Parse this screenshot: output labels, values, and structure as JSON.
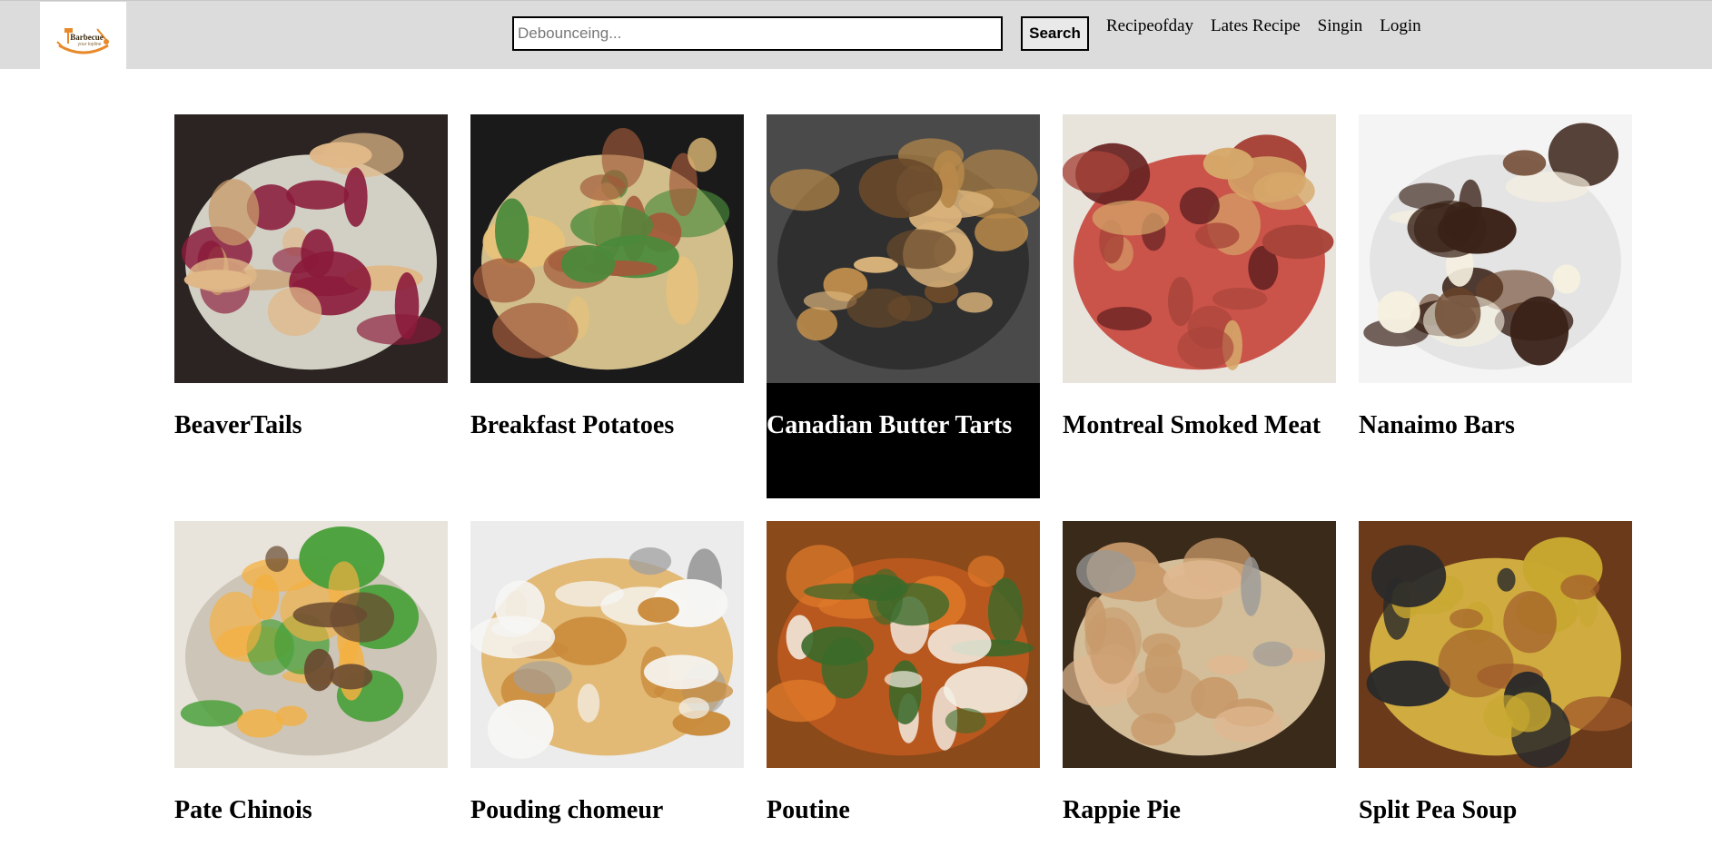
{
  "header": {
    "logo": {
      "text": "Barbecue",
      "subtext": "your topline",
      "icon": "bbq-utensils-icon",
      "accent": "#e8892a"
    },
    "search": {
      "placeholder": "Debounceing...",
      "value": "",
      "button_label": "Search"
    },
    "nav": [
      {
        "label": "Recipeofday"
      },
      {
        "label": "Lates Recipe"
      },
      {
        "label": "Singin"
      },
      {
        "label": "Login"
      }
    ]
  },
  "recipes": [
    {
      "title": "BeaverTails",
      "image": "beavertails-photo",
      "palette": [
        "#2b2422",
        "#c89a6a",
        "#e0b888",
        "#8a1a3a",
        "#f0eee0"
      ]
    },
    {
      "title": "Breakfast Potatoes",
      "image": "breakfast-potatoes-photo",
      "palette": [
        "#1a1a1a",
        "#e8c27a",
        "#a25a3a",
        "#4a8a3a",
        "#f2dca0"
      ]
    },
    {
      "title": "Canadian Butter Tarts",
      "image": "butter-tarts-photo",
      "palette": [
        "#4a4a4a",
        "#b8894a",
        "#6a4a2a",
        "#d9b27a",
        "#2a2a2a"
      ],
      "active": true
    },
    {
      "title": "Montreal Smoked Meat",
      "image": "smoked-meat-photo",
      "palette": [
        "#e8e4dc",
        "#a8443a",
        "#d6a86a",
        "#6a2424",
        "#c43a30"
      ]
    },
    {
      "title": "Nanaimo Bars",
      "image": "nanaimo-bars-photo",
      "palette": [
        "#f4f4f4",
        "#3a2218",
        "#f6f0e0",
        "#6a4228",
        "#e0e0e0"
      ]
    },
    {
      "title": "Pate Chinois",
      "image": "pate-chinois-photo",
      "palette": [
        "#e8e4dc",
        "#f4b040",
        "#6a4a30",
        "#4aa03a",
        "#c8c0b0"
      ]
    },
    {
      "title": "Pouding chomeur",
      "image": "pouding-chomeur-photo",
      "palette": [
        "#ececec",
        "#c98a3a",
        "#f6f6f4",
        "#a0a0a0",
        "#e0b060"
      ]
    },
    {
      "title": "Poutine",
      "image": "poutine-photo",
      "palette": [
        "#8a4a1a",
        "#e07a2a",
        "#f4f0e6",
        "#3a6a2a",
        "#c05a20"
      ]
    },
    {
      "title": "Rappie Pie",
      "image": "rappie-pie-photo",
      "palette": [
        "#3a2a1a",
        "#e0b890",
        "#c89a6a",
        "#9a9a9a",
        "#f0d8b0"
      ]
    },
    {
      "title": "Split Pea Soup",
      "image": "split-pea-soup-photo",
      "palette": [
        "#6a3a1a",
        "#c8a830",
        "#a05a2a",
        "#2a2a2a",
        "#e0c048"
      ]
    }
  ]
}
